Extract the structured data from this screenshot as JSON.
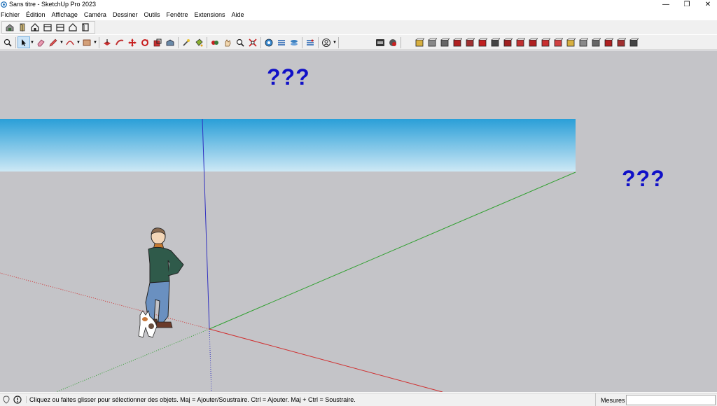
{
  "window": {
    "title": "Sans titre - SketchUp Pro 2023",
    "minimize_glyph": "—",
    "maximize_glyph": "❐",
    "close_glyph": "✕"
  },
  "menu": {
    "items": [
      "Fichier",
      "Édition",
      "Affichage",
      "Caméra",
      "Dessiner",
      "Outils",
      "Fenêtre",
      "Extensions",
      "Aide"
    ]
  },
  "toolbar_row1": {
    "icons": [
      "warehouse-icon",
      "components-icon",
      "iso-view-icon",
      "front-view-icon",
      "back-view-icon",
      "house-view-icon",
      "frame-icon"
    ]
  },
  "toolbar_row2": {
    "icons": [
      "zoom-icon",
      "select-icon",
      "eraser-icon",
      "pencil-icon",
      "arc-icon",
      "rectangle-icon",
      "push-pull-icon",
      "follow-me-icon",
      "move-icon",
      "rotate-icon",
      "scale-icon",
      "offset-icon",
      "tape-measure-icon",
      "paint-bucket-icon",
      "orbit-icon",
      "pan-icon",
      "zoom-window-icon",
      "zoom-extents-icon",
      "section-plane-icon",
      "styles-icon",
      "layers-icon",
      "scenes-icon",
      "account-icon",
      "extension-warehouse-icon",
      "layout-icon"
    ]
  },
  "viewport": {
    "annotation_1": "???",
    "annotation_2": "???",
    "sky_color_top": "#2a9fd8",
    "sky_color_bottom": "#cde8f5",
    "ground_color": "#c4c4c8",
    "axis_red": "#d03030",
    "axis_green": "#30a030",
    "axis_blue": "#3030c0"
  },
  "statusbar": {
    "hint": "Cliquez ou faites glisser pour sélectionner des objets. Maj = Ajouter/Soustraire. Ctrl = Ajouter. Maj + Ctrl = Soustraire.",
    "measures_label": "Mesures",
    "measures_value": ""
  }
}
